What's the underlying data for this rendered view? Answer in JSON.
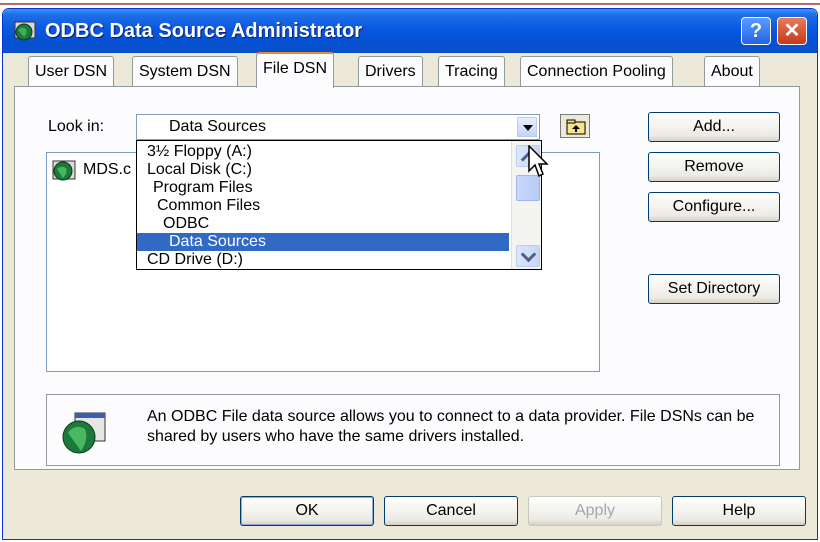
{
  "window": {
    "title": "ODBC Data Source Administrator",
    "help_label": "?",
    "close_label": "✕",
    "icon": "odbc-globe-icon"
  },
  "tabs": [
    {
      "label": "User DSN"
    },
    {
      "label": "System DSN"
    },
    {
      "label": "File DSN",
      "active": true
    },
    {
      "label": "Drivers"
    },
    {
      "label": "Tracing"
    },
    {
      "label": "Connection Pooling"
    },
    {
      "label": "About"
    }
  ],
  "look_in": {
    "label": "Look in:",
    "value": "Data Sources"
  },
  "dropdown": {
    "items": [
      {
        "label": "3½ Floppy (A:)"
      },
      {
        "label": "Local Disk (C:)"
      },
      {
        "label": "Program Files"
      },
      {
        "label": "Common Files"
      },
      {
        "label": "ODBC"
      },
      {
        "label": "Data Sources",
        "selected": true
      },
      {
        "label": "CD Drive (D:)"
      }
    ]
  },
  "file_list": {
    "items": [
      {
        "label": "MDS.c"
      }
    ]
  },
  "side_buttons": {
    "add": "Add...",
    "remove": "Remove",
    "configure": "Configure...",
    "set_directory": "Set Directory"
  },
  "info": {
    "text": "An ODBC File data source allows you to connect to a data provider.  File DSNs can be shared by users who have the same drivers installed."
  },
  "bottom_buttons": {
    "ok": "OK",
    "cancel": "Cancel",
    "apply": "Apply",
    "help": "Help"
  },
  "colors": {
    "titlebar": "#0a58e0",
    "selection": "#316ac5",
    "active_tab_accent": "#e68b2c",
    "dialog_bg": "#ece9d8"
  }
}
